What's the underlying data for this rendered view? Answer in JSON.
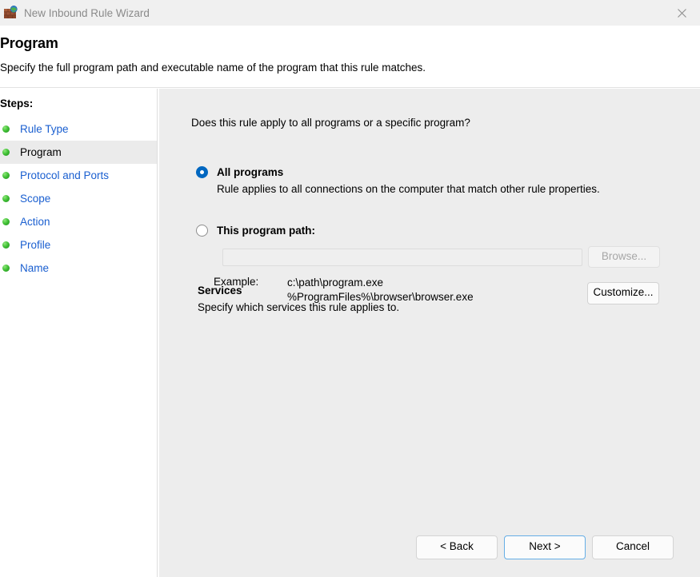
{
  "window": {
    "title": "New Inbound Rule Wizard",
    "icon": "firewall-brick-globe-icon",
    "close_label": "✕",
    "titlebar_bg": "#f0f0f0",
    "title_color": "#8a8a8a"
  },
  "header": {
    "title": "Program",
    "subtitle": "Specify the full program path and executable name of the program that this rule matches."
  },
  "sidebar": {
    "heading": "Steps:",
    "items": [
      {
        "label": "Rule Type",
        "current": false
      },
      {
        "label": "Program",
        "current": true
      },
      {
        "label": "Protocol and Ports",
        "current": false
      },
      {
        "label": "Scope",
        "current": false
      },
      {
        "label": "Action",
        "current": false
      },
      {
        "label": "Profile",
        "current": false
      },
      {
        "label": "Name",
        "current": false
      }
    ],
    "link_color": "#1a5fd0",
    "bullet_color": "#3fbf34",
    "current_row_bg": "#ebebeb"
  },
  "main": {
    "question": "Does this rule apply to all programs or a specific program?",
    "options": [
      {
        "id": "all-programs",
        "label": "All programs",
        "description": "Rule applies to all connections on the computer that match other rule properties.",
        "selected": true
      },
      {
        "id": "this-program-path",
        "label": "This program path:",
        "selected": false
      }
    ],
    "path_input": {
      "value": "",
      "placeholder": "",
      "enabled": false
    },
    "browse_button": {
      "label": "Browse...",
      "enabled": false
    },
    "example": {
      "label": "Example:",
      "values": "c:\\path\\program.exe\n%ProgramFiles%\\browser\\browser.exe"
    },
    "services": {
      "title": "Services",
      "description": "Specify which services this rule applies to.",
      "customize_label": "Customize..."
    },
    "accent_color": "#0067c0",
    "panel_bg": "#ededed"
  },
  "footer": {
    "buttons": [
      {
        "label": "< Back",
        "default": false
      },
      {
        "label": "Next >",
        "default": true
      },
      {
        "label": "Cancel",
        "default": false
      }
    ]
  }
}
